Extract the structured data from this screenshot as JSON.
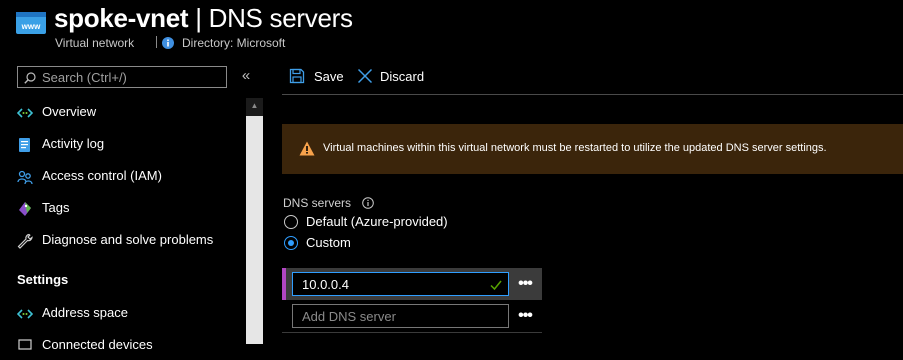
{
  "header": {
    "resource_name": "spoke-vnet",
    "separator": "|",
    "page_title": "DNS servers",
    "resource_type": "Virtual network",
    "directory_label": "Directory: Microsoft"
  },
  "sidebar": {
    "search_placeholder": "Search (Ctrl+/)",
    "collapse_symbol": "«",
    "items": [
      {
        "label": "Overview",
        "icon": "overview-icon"
      },
      {
        "label": "Activity log",
        "icon": "activity-log-icon"
      },
      {
        "label": "Access control (IAM)",
        "icon": "people-icon"
      },
      {
        "label": "Tags",
        "icon": "tag-icon"
      },
      {
        "label": "Diagnose and solve problems",
        "icon": "wrench-icon"
      }
    ],
    "settings_heading": "Settings",
    "settings_items": [
      {
        "label": "Address space",
        "icon": "address-space-icon"
      },
      {
        "label": "Connected devices",
        "icon": "connected-devices-icon"
      }
    ]
  },
  "toolbar": {
    "save_label": "Save",
    "discard_label": "Discard"
  },
  "warning": {
    "text": "Virtual machines within this virtual network must be restarted to utilize the updated DNS server settings."
  },
  "dns": {
    "heading": "DNS servers",
    "options": [
      {
        "label": "Default (Azure-provided)",
        "selected": false
      },
      {
        "label": "Custom",
        "selected": true
      }
    ],
    "servers": [
      {
        "value": "10.0.0.4",
        "valid": true,
        "more_label": "•••"
      }
    ],
    "add_placeholder": "Add DNS server",
    "add_more_label": "•••"
  },
  "colors": {
    "accent": "#2f9eff",
    "warning_bg": "#3b250b",
    "warning_icon": "#f7a24b",
    "row_marker": "#b146c2",
    "valid_check": "#57a300"
  }
}
